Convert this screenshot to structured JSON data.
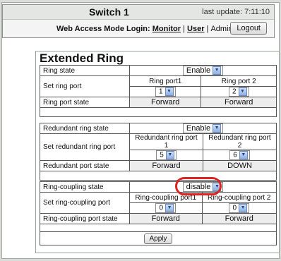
{
  "header": {
    "title": "Switch 1",
    "last_update": "last update: 7:11:10",
    "login_prefix": "Web Access Mode Login:",
    "monitor": "Monitor",
    "sep1": "|",
    "user": "User",
    "sep2": "|",
    "admin": "Admin",
    "logout": "Logout"
  },
  "page": {
    "title": "Extended Ring",
    "apply": "Apply"
  },
  "ring": {
    "state_label": "Ring state",
    "state_value": "Enable",
    "port_label": "Set ring port",
    "port1_header": "Ring port1",
    "port2_header": "Ring port 2",
    "port1_value": "1",
    "port2_value": "2",
    "port_state_label": "Ring port state",
    "port1_state": "Forward",
    "port2_state": "Forward"
  },
  "redundant": {
    "state_label": "Redundant ring state",
    "state_value": "Enable",
    "port_label": "Set redundant ring port",
    "port1_header": "Redundant ring port 1",
    "port2_header": "Redundant ring port 2",
    "port1_value": "5",
    "port2_value": "6",
    "port_state_label": "Redundant port state",
    "port1_state": "Forward",
    "port2_state": "DOWN"
  },
  "coupling": {
    "state_label": "Ring-coupling state",
    "state_value": "disable",
    "port_label": "Set ring-coupling port",
    "port1_header": "Ring-coupling port1",
    "port2_header": "Ring-coupling port 2",
    "port1_value": "0",
    "port2_value": "0",
    "port_state_label": "Ring-coupling port state",
    "port1_state": "Forward",
    "port2_state": "Forward"
  },
  "colors": {
    "highlight": "#dd2222",
    "select_arrow": "#8fb0e0"
  }
}
